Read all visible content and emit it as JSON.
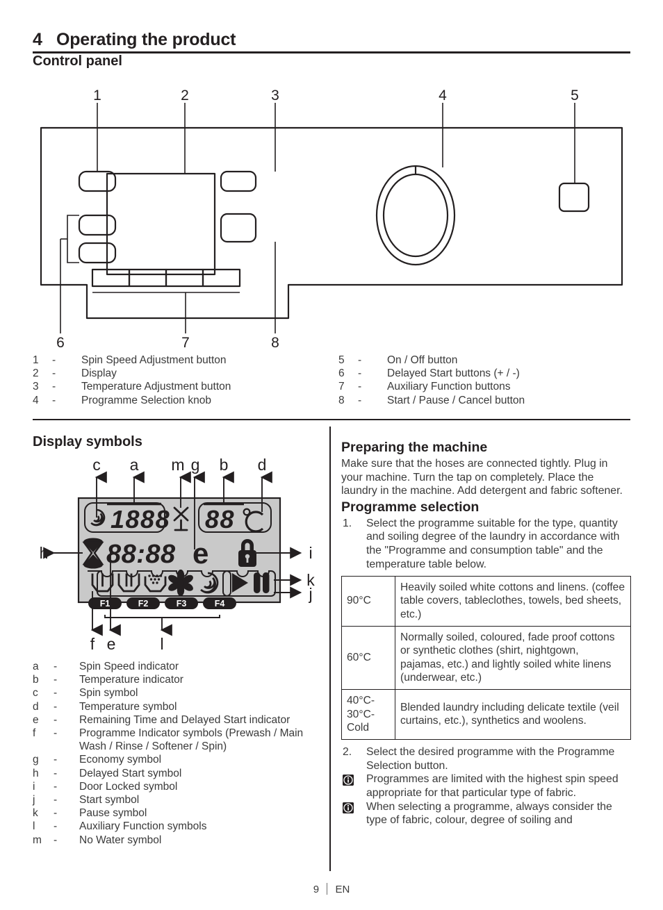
{
  "header": {
    "chapter_number": "4",
    "chapter_title": "Operating the product",
    "section_title": "Control panel"
  },
  "control_panel": {
    "callout_numbers": [
      "1",
      "2",
      "3",
      "4",
      "5",
      "6",
      "7",
      "8"
    ],
    "legend_left": [
      {
        "num": "1",
        "dash": "-",
        "label": "Spin Speed Adjustment button"
      },
      {
        "num": "2",
        "dash": "-",
        "label": "Display"
      },
      {
        "num": "3",
        "dash": "-",
        "label": "Temperature Adjustment button"
      },
      {
        "num": "4",
        "dash": "-",
        "label": "Programme Selection knob"
      }
    ],
    "legend_right": [
      {
        "num": "5",
        "dash": "-",
        "label": "On / Off button"
      },
      {
        "num": "6",
        "dash": "-",
        "label": "Delayed Start buttons (+ / -)"
      },
      {
        "num": "7",
        "dash": "-",
        "label": "Auxiliary Function buttons"
      },
      {
        "num": "8",
        "dash": "-",
        "label": "Start / Pause / Cancel button"
      }
    ]
  },
  "display_symbols": {
    "title": "Display symbols",
    "callout_letters_top": [
      "c",
      "a",
      "m",
      "g",
      "b",
      "d"
    ],
    "callout_letters_left": [
      "h"
    ],
    "callout_letters_right": [
      "i",
      "k",
      "j"
    ],
    "callout_letters_bottom": [
      "f",
      "e",
      "l"
    ],
    "lcd": {
      "spin_speed_value": "1888",
      "temperature_value": "88",
      "temperature_unit": "°C",
      "time_value": "88:88",
      "economy_glyph": "e",
      "function_buttons": [
        "F1",
        "F2",
        "F3",
        "F4"
      ],
      "spin_icon": "spiral-icon",
      "no_water_icon": "tap-no-water-icon",
      "delayed_start_icon": "hourglass-icon",
      "door_locked_icon": "padlock-icon",
      "start_icon": "play-triangle-icon",
      "pause_icon": "pause-bars-icon",
      "programme_icons": [
        "prewash-basin-icon",
        "main-wash-basin-icon",
        "rinse-basin-icon",
        "softener-flower-icon",
        "spin-spiral-icon"
      ]
    },
    "legend": [
      {
        "key": "a",
        "dash": "-",
        "label": "Spin Speed indicator"
      },
      {
        "key": "b",
        "dash": "-",
        "label": "Temperature indicator"
      },
      {
        "key": "c",
        "dash": "-",
        "label": "Spin symbol"
      },
      {
        "key": "d",
        "dash": "-",
        "label": "Temperature symbol"
      },
      {
        "key": "e",
        "dash": "-",
        "label": "Remaining Time and Delayed Start indicator"
      },
      {
        "key": "f",
        "dash": "-",
        "label": "Programme Indicator symbols (Prewash / Main Wash / Rinse / Softener / Spin)"
      },
      {
        "key": "g",
        "dash": "-",
        "label": "Economy symbol"
      },
      {
        "key": "h",
        "dash": "-",
        "label": "Delayed Start symbol"
      },
      {
        "key": "i",
        "dash": "-",
        "label": "Door Locked symbol"
      },
      {
        "key": "j",
        "dash": "-",
        "label": "Start symbol"
      },
      {
        "key": "k",
        "dash": "-",
        "label": "Pause symbol"
      },
      {
        "key": "l",
        "dash": "-",
        "label": "Auxiliary Function symbols"
      },
      {
        "key": "m",
        "dash": "-",
        "label": "No Water symbol"
      }
    ]
  },
  "right_column": {
    "preparing_heading": "Preparing the machine",
    "preparing_body": "Make sure that the hoses are connected tightly. Plug in your machine. Turn the tap on completely. Place the laundry in the machine. Add detergent and fabric softener.",
    "programme_heading": "Programme selection",
    "step1_marker": "1.",
    "step1_text": "Select the programme suitable for the type, quantity and soiling degree of the laundry in accordance with the \"Programme and consumption table\" and the temperature table below.",
    "temperature_table": {
      "rows": [
        {
          "temperature": "90°C",
          "description": "Heavily soiled white cottons and linens. (coffee table covers, tableclothes, towels, bed sheets, etc.)"
        },
        {
          "temperature": "60°C",
          "description": "Normally soiled, coloured, fade proof cottons or synthetic clothes (shirt, nightgown, pajamas, etc.) and lightly soiled white linens (underwear, etc.)"
        },
        {
          "temperature": "40°C-\n30°C-\nCold",
          "description": "Blended laundry including delicate textile (veil curtains, etc.), synthetics and woolens."
        }
      ]
    },
    "step2_marker": "2.",
    "step2_text": "Select the desired programme with the Programme Selection button.",
    "note1_text": "Programmes are limited with the highest spin speed appropriate for that particular type of fabric.",
    "note2_text": "When selecting a programme, always consider the type of fabric, colour, degree of soiling and"
  },
  "footer": {
    "page_number": "9",
    "language": "EN"
  },
  "colors": {
    "ink": "#231f20",
    "body_text": "#3a3a3a",
    "lcd_background": "#c9c9c9"
  }
}
